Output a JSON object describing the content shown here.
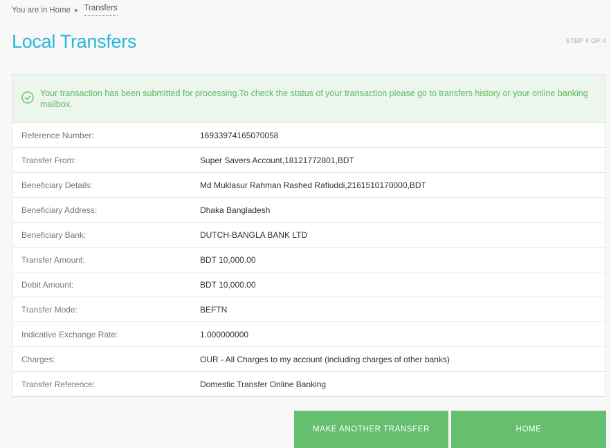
{
  "breadcrumb": {
    "prefix": "You are in",
    "home": "Home",
    "separator": "▶",
    "current": "Transfers"
  },
  "page": {
    "title": "Local Transfers",
    "step": "STEP 4 OF 4"
  },
  "alert": {
    "message": "Your transaction has been submitted for processing.To check the status of your transaction please go to transfers history or your online banking mailbox.",
    "icon": "check-circle-icon",
    "color": "#5cb85c"
  },
  "details": [
    {
      "label": "Reference Number:",
      "value": "16933974165070058"
    },
    {
      "label": "Transfer From:",
      "value": "Super Savers Account,18121772801,BDT"
    },
    {
      "label": "Beneficiary Details:",
      "value": "Md Muklasur Rahman Rashed Rafiuddi,2161510170000,BDT"
    },
    {
      "label": "Beneficiary Address:",
      "value": "Dhaka Bangladesh"
    },
    {
      "label": "Beneficiary Bank:",
      "value": "DUTCH-BANGLA BANK LTD"
    },
    {
      "label": "Transfer Amount:",
      "value": "BDT 10,000.00"
    },
    {
      "label": "Debit Amount:",
      "value": "BDT 10,000.00"
    },
    {
      "label": "Transfer Mode:",
      "value": "BEFTN"
    },
    {
      "label": "Indicative Exchange Rate:",
      "value": "1.000000000"
    },
    {
      "label": "Charges:",
      "value": "OUR - All Charges to my account (including charges of other banks)"
    },
    {
      "label": "Transfer Reference:",
      "value": "Domestic Transfer Online Banking"
    }
  ],
  "actions": {
    "another_label": "MAKE ANOTHER TRANSFER",
    "home_label": "HOME",
    "color": "#66bf6f"
  },
  "colors": {
    "title": "#29b6d8",
    "alert_bg": "#ecf6ec"
  }
}
